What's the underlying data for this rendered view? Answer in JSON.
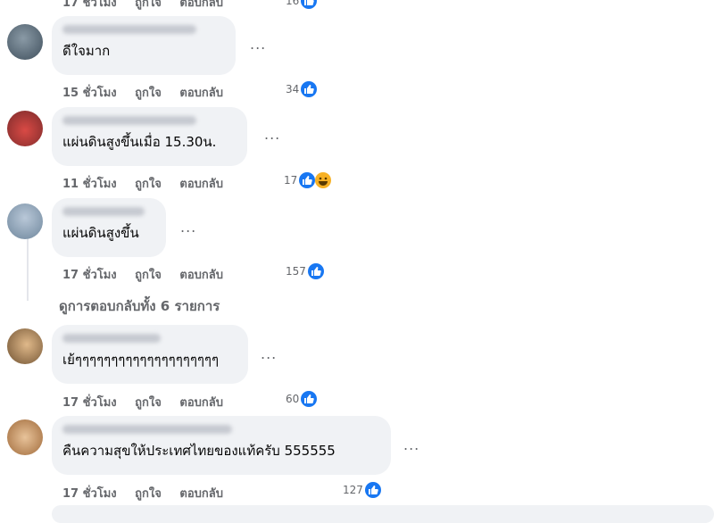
{
  "comments": [
    {
      "text": "ดีใจมาก",
      "time": "15 ชั่วโมง",
      "likes": "34"
    },
    {
      "text": "แผ่นดินสูงขึ้นเมื่อ 15.30น.",
      "time": "11 ชั่วโมง",
      "likes": "17"
    },
    {
      "text": "แผ่นดินสูงขึ้น",
      "time": "17 ชั่วโมง",
      "likes": "157"
    },
    {
      "text": "เย้ๆๆๆๆๆๆๆๆๆๆๆๆๆๆๆๆๆๆๆๆ",
      "time": "17 ชั่วโมง",
      "likes": "60"
    },
    {
      "text": "คืนความสุขให้ประเทศไทยของแท้ครับ 555555",
      "time": "17 ชั่วโมง",
      "likes": "127"
    }
  ],
  "top_partial": {
    "time": "17 ชั่วโมง",
    "likes": "16"
  },
  "actions": {
    "like": "ถูกใจ",
    "reply": "ตอบกลับ"
  },
  "more_label": "...",
  "view_replies": "ดูการตอบกลับทั้ง 6 รายการ",
  "colors": {
    "like_blue": "#1877f2",
    "bubble": "#f0f2f5",
    "meta": "#65676b"
  }
}
